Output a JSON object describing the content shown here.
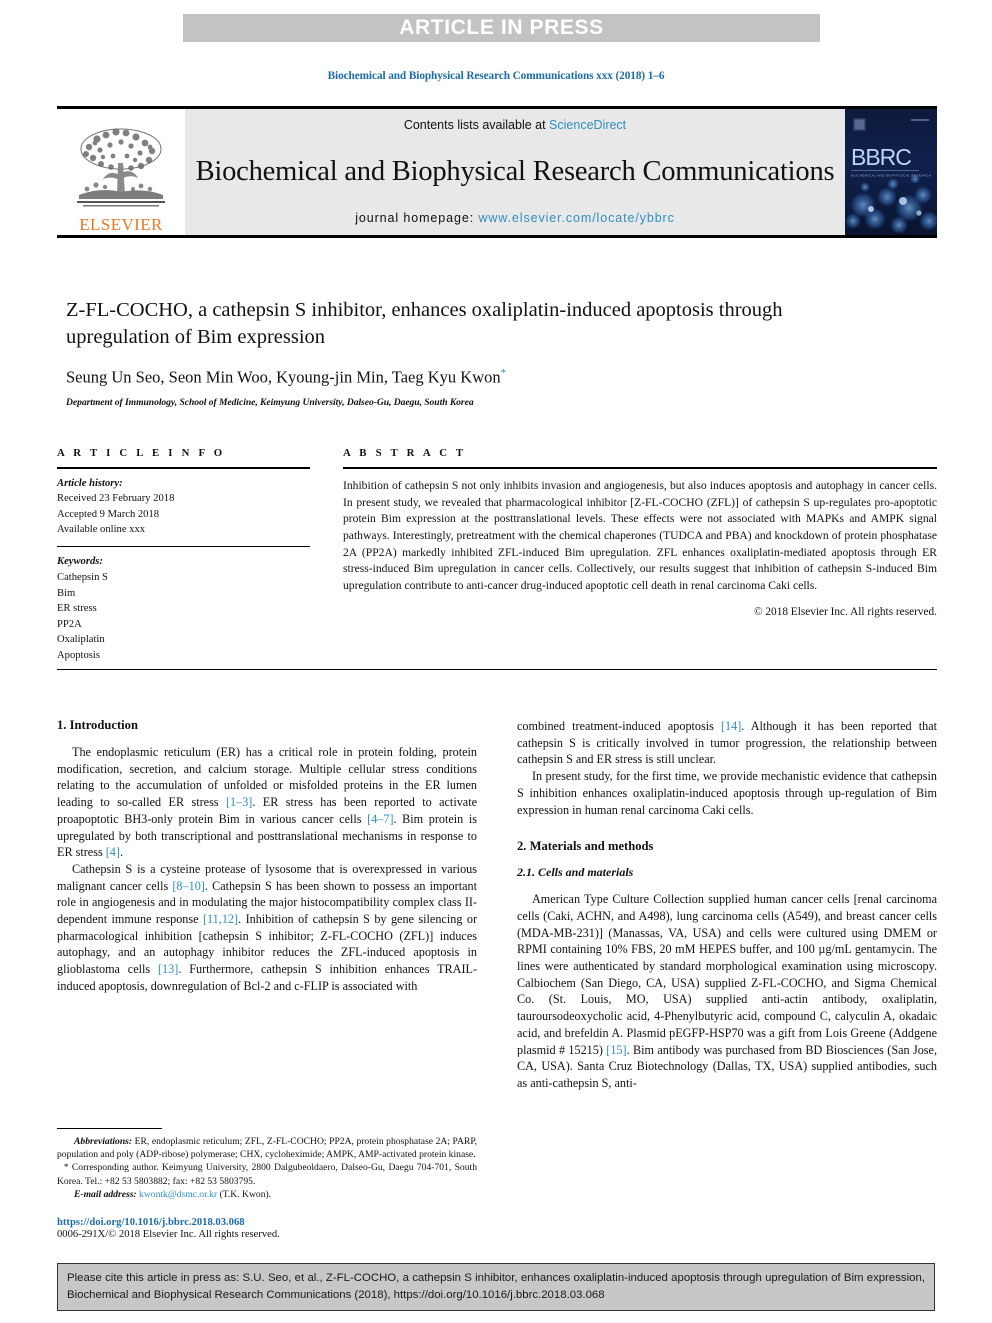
{
  "banner": {
    "text": "ARTICLE IN PRESS"
  },
  "journal_ref": "Biochemical and Biophysical Research Communications xxx (2018) 1–6",
  "masthead": {
    "publisher": "ELSEVIER",
    "contents_prefix": "Contents lists available at ",
    "contents_link": "ScienceDirect",
    "journal_title": "Biochemical and Biophysical Research Communications",
    "homepage_prefix": "journal homepage: ",
    "homepage_url": "www.elsevier.com/locate/ybbrc",
    "cover_title": "BBRC",
    "cover_subtitle": "BIOCHEMICAL AND BIOPHYSICAL RESEARCH COMMUNICATIONS"
  },
  "article": {
    "title": "Z-FL-COCHO, a cathepsin S inhibitor, enhances oxaliplatin-induced apoptosis through upregulation of Bim expression",
    "authors": "Seung Un Seo, Seon Min Woo, Kyoung-jin Min, Taeg Kyu Kwon",
    "corresponding_marker": "*",
    "affiliation": "Department of Immunology, School of Medicine, Keimyung University, Dalseo-Gu, Daegu, South Korea"
  },
  "article_info": {
    "heading": "A R T I C L E   I N F O",
    "history_label": "Article history:",
    "history": [
      "Received 23 February 2018",
      "Accepted 9 March 2018",
      "Available online xxx"
    ],
    "keywords_label": "Keywords:",
    "keywords": [
      "Cathepsin S",
      "Bim",
      "ER stress",
      "PP2A",
      "Oxaliplatin",
      "Apoptosis"
    ]
  },
  "abstract": {
    "heading": "A B S T R A C T",
    "text": "Inhibition of cathepsin S not only inhibits invasion and angiogenesis, but also induces apoptosis and autophagy in cancer cells. In present study, we revealed that pharmacological inhibitor [Z-FL-COCHO (ZFL)] of cathepsin S up-regulates pro-apoptotic protein Bim expression at the posttranslational levels. These effects were not associated with MAPKs and AMPK signal pathways. Interestingly, pretreatment with the chemical chaperones (TUDCA and PBA) and knockdown of protein phosphatase 2A (PP2A) markedly inhibited ZFL-induced Bim upregulation. ZFL enhances oxaliplatin-mediated apoptosis through ER stress-induced Bim upregulation in cancer cells. Collectively, our results suggest that inhibition of cathepsin S-induced Bim upregulation contribute to anti-cancer drug-induced apoptotic cell death in renal carcinoma Caki cells.",
    "copyright": "© 2018 Elsevier Inc. All rights reserved."
  },
  "body": {
    "left": {
      "intro_heading": "1.  Introduction",
      "para1_a": "The endoplasmic reticulum (ER) has a critical role in protein folding, protein modification, secretion, and calcium storage. Multiple cellular stress conditions relating to the accumulation of unfolded or misfolded proteins in the ER lumen leading to so-called ER stress ",
      "para1_ref1": "[1–3]",
      "para1_b": ". ER stress has been reported to activate proapoptotic BH3-only protein Bim in various cancer cells ",
      "para1_ref2": "[4–7]",
      "para1_c": ". Bim protein is upregulated by both transcriptional and posttranslational mechanisms in response to ER stress ",
      "para1_ref3": "[4]",
      "para1_d": ".",
      "para2_a": "Cathepsin S is a cysteine protease of lysosome that is overexpressed in various malignant cancer cells ",
      "para2_ref1": "[8–10]",
      "para2_b": ". Cathepsin S has been shown to possess an important role in angiogenesis and in modulating the major histocompatibility complex class II-dependent immune response ",
      "para2_ref2": "[11,12]",
      "para2_c": ". Inhibition of cathepsin S by gene silencing or pharmacological inhibition [cathepsin S inhibitor; Z-FL-COCHO (ZFL)] induces autophagy, and an autophagy inhibitor reduces the ZFL-induced apoptosis in glioblastoma cells ",
      "para2_ref3": "[13]",
      "para2_d": ". Furthermore, cathepsin S inhibition enhances TRAIL-induced apoptosis, downregulation of Bcl-2 and c-FLIP is associated with"
    },
    "right": {
      "para1_a": "combined treatment-induced apoptosis ",
      "para1_ref1": "[14]",
      "para1_b": ". Although it has been reported that cathepsin S is critically involved in tumor progression, the relationship between cathepsin S and ER stress is still unclear.",
      "para2": "In present study, for the first time, we provide mechanistic evidence that cathepsin S inhibition enhances oxaliplatin-induced apoptosis through up-regulation of Bim expression in human renal carcinoma Caki cells.",
      "methods_heading": "2.  Materials and methods",
      "sub_heading": "2.1.  Cells and materials",
      "para3_a": "American Type Culture Collection supplied human cancer cells [renal carcinoma cells (Caki, ACHN, and A498), lung carcinoma cells (A549), and breast cancer cells (MDA-MB-231)] (Manassas, VA, USA) and cells were cultured using DMEM or RPMI containing 10% FBS, 20 mM HEPES buffer, and 100 µg/mL gentamycin. The lines were authenticated by standard morphological examination using microscopy. Calbiochem (San Diego, CA, USA) supplied Z-FL-COCHO, and Sigma Chemical Co. (St. Louis, MO, USA) supplied anti-actin antibody, oxaliplatin, tauroursodeoxycholic acid, 4-Phenylbutyric acid, compound C, calyculin A, okadaic acid, and brefeldin A. Plasmid pEGFP-HSP70 was a gift from Lois Greene (Addgene plasmid # 15215) ",
      "para3_ref1": "[15]",
      "para3_b": ". Bim antibody was purchased from BD Biosciences (San Jose, CA, USA). Santa Cruz Biotechnology (Dallas, TX, USA) supplied antibodies, such as anti-cathepsin S, anti-"
    }
  },
  "footnotes": {
    "abbrev_label": "Abbreviations:",
    "abbrev_text": " ER, endoplasmic reticulum; ZFL, Z-FL-COCHO; PP2A, protein phosphatase 2A; PARP, population and poly (ADP-ribose) polymerase; CHX, cycloheximide; AMPK, AMP-activated protein kinase.",
    "corresponding_marker": "*",
    "corresponding_text": " Corresponding author. Keimyung University, 2800 Dalgubeoldaero, Dalseo-Gu, Daegu 704-701, South Korea. Tel.: +82 53 5803882; fax: +82 53 5803795.",
    "email_label": "E-mail address:",
    "email": "kwontk@dsmc.or.kr",
    "email_owner": " (T.K. Kwon).",
    "doi": "https://doi.org/10.1016/j.bbrc.2018.03.068",
    "issn": "0006-291X/© 2018 Elsevier Inc. All rights reserved."
  },
  "citation_box": {
    "text": "Please cite this article in press as: S.U. Seo, et al., Z-FL-COCHO, a cathepsin S inhibitor, enhances oxaliplatin-induced apoptosis through upregulation of Bim expression, Biochemical and Biophysical Research Communications (2018), https://doi.org/10.1016/j.bbrc.2018.03.068"
  },
  "colors": {
    "link_blue": "#2e8fc0",
    "ref_blue": "#1b6ca8",
    "elsevier_orange": "#e87722",
    "banner_gray": "#c3c3c3",
    "masthead_gray": "#e8e8e8",
    "cite_box_gray": "#c7c7c7"
  }
}
